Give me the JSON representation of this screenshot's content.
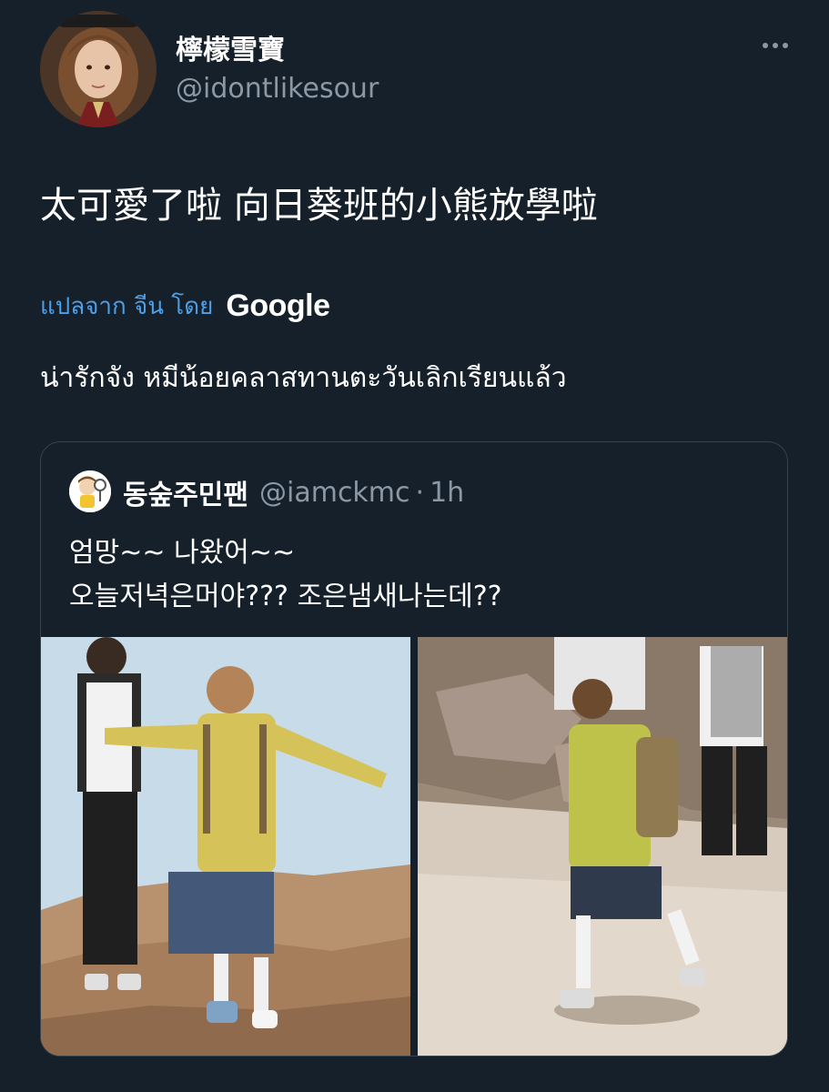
{
  "tweet": {
    "display_name": "檸檬雪寶",
    "handle": "@idontlikesour",
    "text": "太可愛了啦 向日葵班的小熊放學啦",
    "translate_label": "แปลจาก จีน โดย",
    "translate_provider": "Google",
    "translated_text": "น่ารักจัง หมีน้อยคลาสทานตะวันเลิกเรียนแล้ว",
    "more_icon": "more-horizontal-icon"
  },
  "quote": {
    "display_name": "동숲주민팬",
    "handle": "@iamckmc",
    "separator": "·",
    "time": "1h",
    "text_lines": [
      "엄망~~ 나왔어~~",
      "오늘저녁은머야??? 조은냄새나는데??"
    ]
  },
  "colors": {
    "background": "#15202b",
    "text_primary": "#ffffff",
    "text_secondary": "#8b98a5",
    "link": "#4f9fe6",
    "border": "#38444d"
  }
}
